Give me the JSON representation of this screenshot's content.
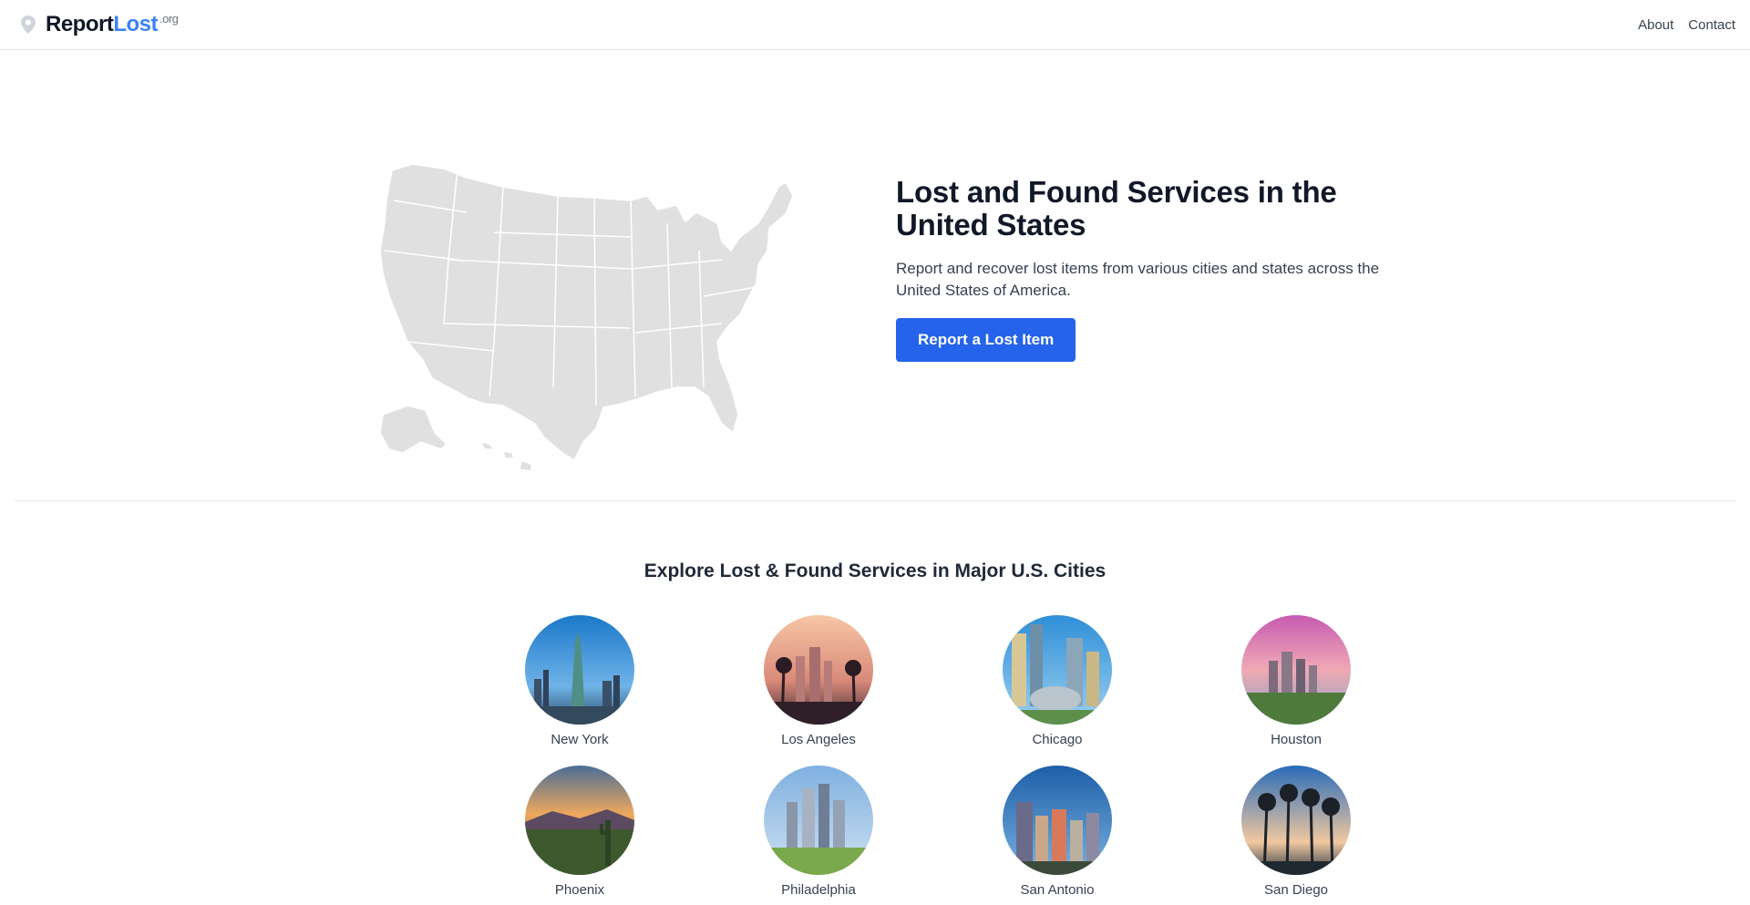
{
  "header": {
    "brand_main": "Report",
    "brand_accent": "Lost",
    "brand_tld": ".org",
    "nav": [
      "About",
      "Contact"
    ]
  },
  "hero": {
    "title": "Lost and Found Services in the United States",
    "subtitle": "Report and recover lost items from various cities and states across the United States of America.",
    "cta_label": "Report a Lost Item"
  },
  "cities": {
    "title": "Explore Lost & Found Services in Major U.S. Cities",
    "items": [
      {
        "name": "New York"
      },
      {
        "name": "Los Angeles"
      },
      {
        "name": "Chicago"
      },
      {
        "name": "Houston"
      },
      {
        "name": "Phoenix"
      },
      {
        "name": "Philadelphia"
      },
      {
        "name": "San Antonio"
      },
      {
        "name": "San Diego"
      }
    ]
  },
  "colors": {
    "accent": "#2563eb",
    "brand_blue": "#3b82f6",
    "map_fill": "#e0e0e0"
  }
}
